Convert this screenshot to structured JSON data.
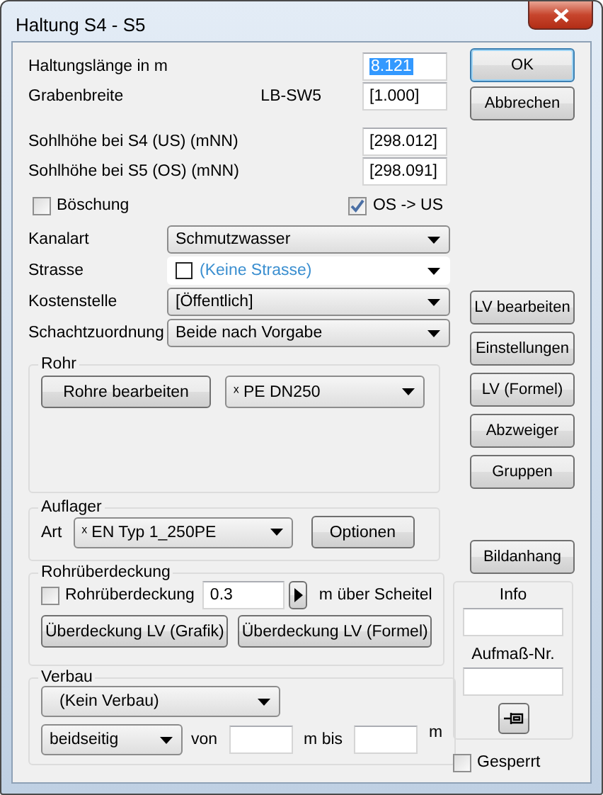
{
  "window": {
    "title": "Haltung S4 - S5"
  },
  "fields": [
    {
      "label": "Haltungslänge in m",
      "value": "8.121",
      "selected": true
    },
    {
      "label": "Grabenbreite",
      "note": "LB-SW5",
      "value": "[1.000]",
      "selected": false
    },
    {
      "label": "Sohlhöhe bei S4 (US) (mNN)",
      "value": "[298.012]",
      "selected": false
    },
    {
      "label": "Sohlhöhe bei S5 (OS) (mNN)",
      "value": "[298.091]",
      "selected": false
    }
  ],
  "checks": [
    {
      "label": "Böschung",
      "checked": false
    },
    {
      "label": "OS -> US",
      "checked": true
    }
  ],
  "combos": [
    {
      "label": "Kanalart",
      "value": "Schmutzwasser",
      "kind": "plain"
    },
    {
      "label": "Strasse",
      "value": "(Keine Strasse)",
      "kind": "swatch"
    },
    {
      "label": "Kostenstelle",
      "value": "[Öffentlich]",
      "kind": "plain"
    },
    {
      "label": "Schachtzuordnung",
      "value": "Beide nach Vorgabe",
      "kind": "plain"
    }
  ],
  "rohr": {
    "title": "Rohr",
    "button": "Rohre bearbeiten",
    "combo": "ˣ PE DN250"
  },
  "auflager": {
    "title": "Auflager",
    "label": "Art",
    "combo": "ˣ EN Typ 1_250PE",
    "button": "Optionen"
  },
  "ueberdeckung": {
    "title": "Rohrüberdeckung",
    "check": {
      "label": "Rohrüberdeckung",
      "checked": false
    },
    "value": "0.3",
    "unit": "m über Scheitel",
    "buttons": [
      "Überdeckung LV (Grafik)",
      "Überdeckung LV (Formel)"
    ]
  },
  "verbau": {
    "title": "Verbau",
    "combo": "(Kein Verbau)",
    "side": "beidseitig",
    "from_label": "von",
    "to_label": "m  bis",
    "unit": "m"
  },
  "top_buttons": [
    {
      "label": "OK",
      "default": true
    },
    {
      "label": "Abbrechen",
      "default": false
    }
  ],
  "tool_buttons": [
    "LV bearbeiten",
    "Einstellungen",
    "LV (Formel)",
    "Abzweiger",
    "Gruppen"
  ],
  "image_button": "Bildanhang",
  "info": {
    "title": "Info",
    "field_label": "Aufmaß-Nr."
  },
  "locked": {
    "label": "Gesperrt",
    "checked": false
  }
}
